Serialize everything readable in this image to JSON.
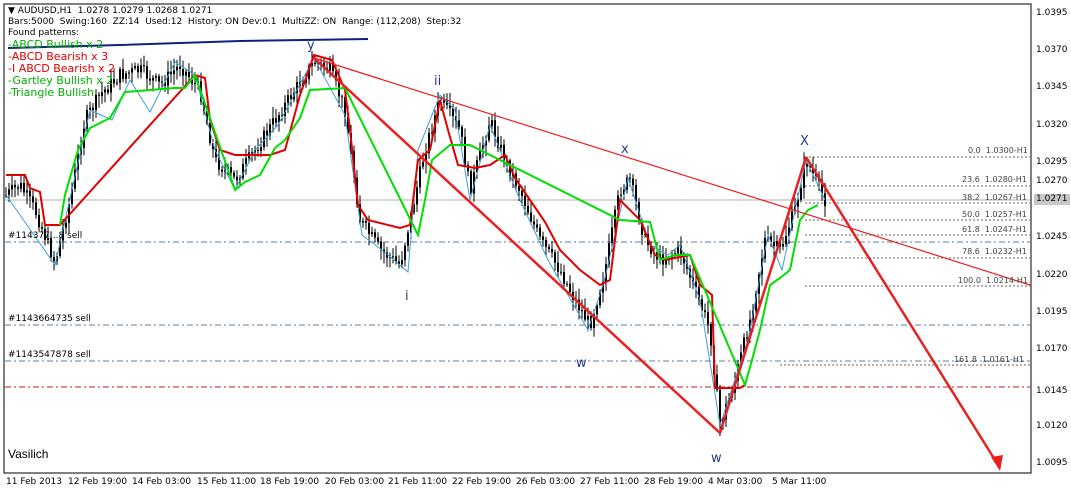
{
  "header": {
    "title_line": "AUDUSD,H1  1.0278 1.0279 1.0268 1.0271",
    "info_line": "Bars:5000  Swing:160  ZZ:14  Used:12  History: ON Dev:0.1  MultiZZ: ON  Range: (112,208)  Step:32",
    "patterns_title": "Found patterns:",
    "patterns": [
      {
        "text": "-ABCD Bullish x 2",
        "color": "#00b000"
      },
      {
        "text": "-ABCD Bearish x 3",
        "color": "#e00000"
      },
      {
        "text": "-I ABCD Bearish x 2",
        "color": "#e00000"
      },
      {
        "text": "-Gartley Bullish x 2",
        "color": "#00b000"
      },
      {
        "text": "-Triangle Bullish",
        "color": "#00b000"
      }
    ]
  },
  "price_axis": {
    "ticks": [
      "1.0395",
      "1.0370",
      "1.0345",
      "1.0320",
      "1.0295",
      "1.0270",
      "1.0245",
      "1.0220",
      "1.0195",
      "1.0170",
      "1.0145",
      "1.0120",
      "1.0095"
    ],
    "current_price": "1.0271"
  },
  "time_axis": {
    "labels": [
      "11 Feb 2013",
      "12 Feb 19:00",
      "14 Feb 03:00",
      "15 Feb 11:00",
      "18 Feb 19:00",
      "20 Feb 03:00",
      "21 Feb 11:00",
      "22 Feb 19:00",
      "26 Feb 03:00",
      "27 Feb 11:00",
      "28 Feb 19:00",
      "4 Mar 03:00",
      "5 Mar 11:00"
    ]
  },
  "fib_levels": [
    "0.0  1.0300-H1",
    "23.6  1.0280-H1",
    "38.2  1.0267-H1",
    "50.0  1.0257-H1",
    "61.8  1.0247-H1",
    "78.6  1.0232-H1",
    "100.0  1.0214-H1",
    "161.8  1.0161-H1"
  ],
  "orders": [
    "#114377...8 sell",
    "#1143664735 sell",
    "#1143547878 sell"
  ],
  "wave_labels": {
    "y": "y",
    "ii": "ii",
    "i": "i",
    "x1": "x",
    "w1": "w",
    "w2": "w",
    "x2": "X"
  },
  "credit": "Vasilich",
  "colors": {
    "candles": "#000000",
    "trail_red": "#e00000",
    "trail_green": "#00e000",
    "zigzag": "#3aa0d8",
    "pattern": "#e82020",
    "dark_blue": "#102080"
  }
}
